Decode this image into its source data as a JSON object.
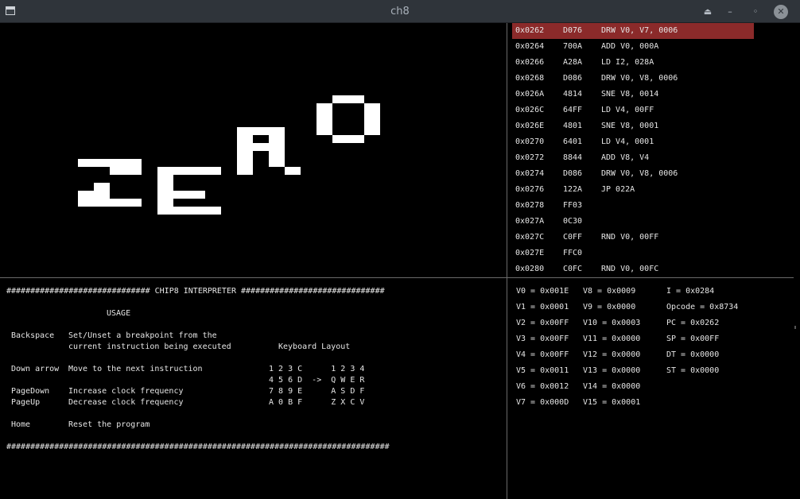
{
  "window": {
    "title": "ch8"
  },
  "titlebar": {
    "app_icon": "window-icon",
    "controls": [
      "shade-icon",
      "minimize-icon",
      "restore-icon",
      "close-icon"
    ],
    "shade_glyph": "⏏",
    "minimize_glyph": "–",
    "restore_glyph": "◦",
    "close_glyph": "✕"
  },
  "colors": {
    "highlight": "#8b2a2a",
    "background": "#000000",
    "text": "#e6e6e6"
  },
  "disassembly": [
    {
      "addr": "0x0262",
      "opcode": "D076",
      "instr": "DRW V0, V7, 0006",
      "current": true
    },
    {
      "addr": "0x0264",
      "opcode": "700A",
      "instr": "ADD V0, 000A"
    },
    {
      "addr": "0x0266",
      "opcode": "A28A",
      "instr": "LD I2, 028A"
    },
    {
      "addr": "0x0268",
      "opcode": "D086",
      "instr": "DRW V0, V8, 0006"
    },
    {
      "addr": "0x026A",
      "opcode": "4814",
      "instr": "SNE V8, 0014"
    },
    {
      "addr": "0x026C",
      "opcode": "64FF",
      "instr": "LD V4, 00FF"
    },
    {
      "addr": "0x026E",
      "opcode": "4801",
      "instr": "SNE V8, 0001"
    },
    {
      "addr": "0x0270",
      "opcode": "6401",
      "instr": "LD V4, 0001"
    },
    {
      "addr": "0x0272",
      "opcode": "8844",
      "instr": "ADD V8, V4"
    },
    {
      "addr": "0x0274",
      "opcode": "D086",
      "instr": "DRW V0, V8, 0006"
    },
    {
      "addr": "0x0276",
      "opcode": "122A",
      "instr": "JP 022A"
    },
    {
      "addr": "0x0278",
      "opcode": "FF03",
      "instr": ""
    },
    {
      "addr": "0x027A",
      "opcode": "0C30",
      "instr": ""
    },
    {
      "addr": "0x027C",
      "opcode": "C0FF",
      "instr": "RND V0, 00FF"
    },
    {
      "addr": "0x027E",
      "opcode": "FFC0",
      "instr": ""
    },
    {
      "addr": "0x0280",
      "opcode": "C0FC",
      "instr": "RND V0, 00FC"
    }
  ],
  "usage": {
    "header": "############################## CHIP8 INTERPRETER ##############################",
    "title": "USAGE",
    "backspace_key": "Backspace",
    "backspace_desc_1": "Set/Unset a breakpoint from the",
    "backspace_desc_2": "current instruction being executed",
    "keyboard_layout_title": "Keyboard Layout",
    "down_key": "Down arrow",
    "down_desc": "Move to the next instruction",
    "pagedown_key": "PageDown",
    "pagedown_desc": "Increase clock frequency",
    "pageup_key": "PageUp",
    "pageup_desc": "Decrease clock frequency",
    "home_key": "Home",
    "home_desc": "Reset the program",
    "kb_row1": "1 2 3 C      1 2 3 4",
    "kb_row2": "4 5 6 D  ->  Q W E R",
    "kb_row3": "7 8 9 E      A S D F",
    "kb_row4": "A 0 B F      Z X C V",
    "footer": "################################################################################"
  },
  "registers": {
    "col1": [
      "V0 = 0x001E",
      "V1 = 0x0001",
      "V2 = 0x00FF",
      "V3 = 0x00FF",
      "V4 = 0x00FF",
      "V5 = 0x0011",
      "V6 = 0x0012",
      "V7 = 0x000D"
    ],
    "col2": [
      "V8 = 0x0009",
      "V9 = 0x0000",
      "V10 = 0x0003",
      "V11 = 0x0000",
      "V12 = 0x0000",
      "V13 = 0x0000",
      "V14 = 0x0000",
      "V15 = 0x0001"
    ],
    "col3": [
      "I = 0x0284",
      "Opcode = 0x8734",
      "PC = 0x0262",
      "SP = 0x00FF",
      "DT = 0x0000",
      "ST = 0x0000"
    ]
  }
}
